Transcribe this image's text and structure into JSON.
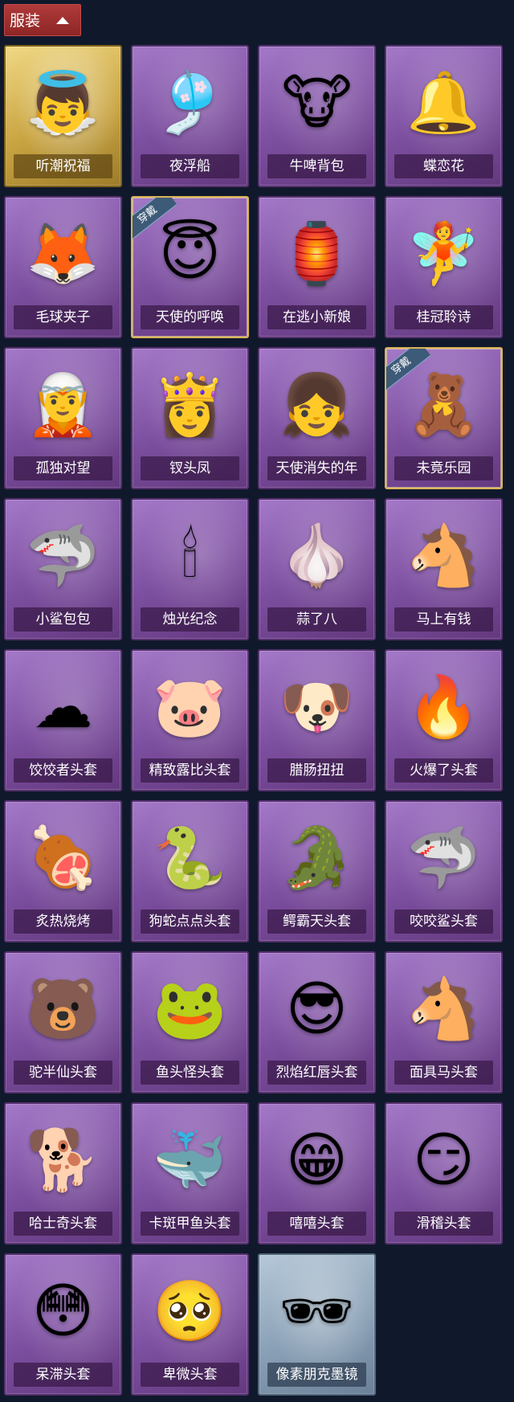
{
  "section": {
    "title": "服装"
  },
  "colors": {
    "background": "#10192b",
    "header_red": "#9d2f2f",
    "card_purple": "#8a5bb0",
    "card_gold": "#d4b04e",
    "card_silver": "#8aa0b6"
  },
  "items": [
    {
      "name": "听潮祝福",
      "rarity": "gold",
      "icon": "👼",
      "worn_badge": ""
    },
    {
      "name": "夜浮船",
      "rarity": "purple",
      "icon": "🎐",
      "worn_badge": ""
    },
    {
      "name": "牛啤背包",
      "rarity": "purple",
      "icon": "🐮",
      "worn_badge": ""
    },
    {
      "name": "蝶恋花",
      "rarity": "purple",
      "icon": "🔔",
      "worn_badge": ""
    },
    {
      "name": "毛球夹子",
      "rarity": "purple",
      "icon": "🦊",
      "worn_badge": ""
    },
    {
      "name": "天使的呼唤",
      "rarity": "purple",
      "icon": "😇",
      "worn_badge": "穿戴"
    },
    {
      "name": "在逃小新娘",
      "rarity": "purple",
      "icon": "🏮",
      "worn_badge": ""
    },
    {
      "name": "桂冠聆诗",
      "rarity": "purple",
      "icon": "🧚",
      "worn_badge": ""
    },
    {
      "name": "孤独对望",
      "rarity": "purple",
      "icon": "🧝",
      "worn_badge": ""
    },
    {
      "name": "钗头凤",
      "rarity": "purple",
      "icon": "👸",
      "worn_badge": ""
    },
    {
      "name": "天使消失的年",
      "rarity": "purple",
      "icon": "👧",
      "worn_badge": ""
    },
    {
      "name": "未竟乐园",
      "rarity": "purple",
      "icon": "🧸",
      "worn_badge": "穿戴"
    },
    {
      "name": "小鲨包包",
      "rarity": "purple",
      "icon": "🦈",
      "worn_badge": ""
    },
    {
      "name": "烛光纪念",
      "rarity": "purple",
      "icon": "🕯",
      "worn_badge": ""
    },
    {
      "name": "蒜了八",
      "rarity": "purple",
      "icon": "🧄",
      "worn_badge": ""
    },
    {
      "name": "马上有钱",
      "rarity": "purple",
      "icon": "🐴",
      "worn_badge": ""
    },
    {
      "name": "饺饺者头套",
      "rarity": "purple",
      "icon": "☁",
      "worn_badge": ""
    },
    {
      "name": "精致露比头套",
      "rarity": "purple",
      "icon": "🐷",
      "worn_badge": ""
    },
    {
      "name": "腊肠扭扭",
      "rarity": "purple",
      "icon": "🐶",
      "worn_badge": ""
    },
    {
      "name": "火爆了头套",
      "rarity": "purple",
      "icon": "🔥",
      "worn_badge": ""
    },
    {
      "name": "炙热烧烤",
      "rarity": "purple",
      "icon": "🍖",
      "worn_badge": ""
    },
    {
      "name": "狗蛇点点头套",
      "rarity": "purple",
      "icon": "🐍",
      "worn_badge": ""
    },
    {
      "name": "鳄霸天头套",
      "rarity": "purple",
      "icon": "🐊",
      "worn_badge": ""
    },
    {
      "name": "咬咬鲨头套",
      "rarity": "purple",
      "icon": "🦈",
      "worn_badge": ""
    },
    {
      "name": "驼半仙头套",
      "rarity": "purple",
      "icon": "🐻",
      "worn_badge": ""
    },
    {
      "name": "鱼头怪头套",
      "rarity": "purple",
      "icon": "🐸",
      "worn_badge": ""
    },
    {
      "name": "烈焰红唇头套",
      "rarity": "purple",
      "icon": "😎",
      "worn_badge": ""
    },
    {
      "name": "面具马头套",
      "rarity": "purple",
      "icon": "🐴",
      "worn_badge": ""
    },
    {
      "name": "哈士奇头套",
      "rarity": "purple",
      "icon": "🐕",
      "worn_badge": ""
    },
    {
      "name": "卡斑甲鱼头套",
      "rarity": "purple",
      "icon": "🐳",
      "worn_badge": ""
    },
    {
      "name": "嘻嘻头套",
      "rarity": "purple",
      "icon": "😁",
      "worn_badge": ""
    },
    {
      "name": "滑稽头套",
      "rarity": "purple",
      "icon": "😏",
      "worn_badge": ""
    },
    {
      "name": "呆滞头套",
      "rarity": "purple",
      "icon": "😳",
      "worn_badge": ""
    },
    {
      "name": "卑微头套",
      "rarity": "purple",
      "icon": "🥺",
      "worn_badge": ""
    },
    {
      "name": "像素朋克墨镜",
      "rarity": "silver",
      "icon": "🕶",
      "worn_badge": ""
    }
  ]
}
